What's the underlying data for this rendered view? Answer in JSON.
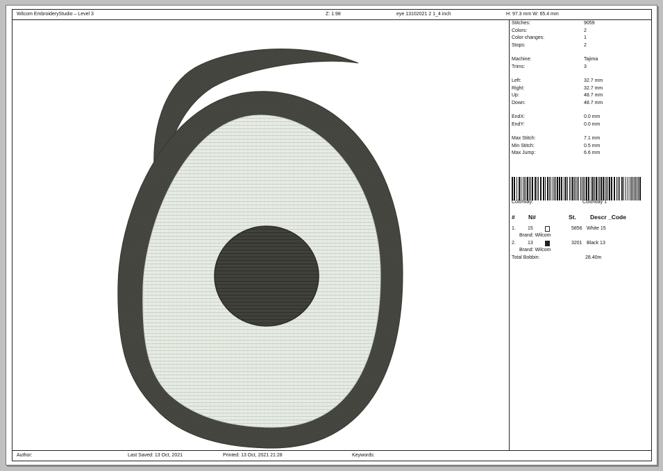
{
  "window": {
    "title": "Wilcom EmbroideryStudio – Level 3"
  },
  "header": {
    "app": "Wilcom EmbroideryStudio – Level 3",
    "zoom": "Z: 1.98",
    "file": "eye 13102021 2  1_4 inch",
    "size": "H: 97.3 mm   W: 65.4 mm"
  },
  "stats": [
    {
      "label": "Stitches:",
      "value": "9059"
    },
    {
      "label": "Colors:",
      "value": "2"
    },
    {
      "label": "Color changes:",
      "value": "1"
    },
    {
      "label": "Stops:",
      "value": "2"
    },
    {
      "label": "Machine:",
      "value": "Tajima"
    },
    {
      "label": "Trims:",
      "value": "3"
    },
    {
      "label": "Left:",
      "value": "32.7 mm"
    },
    {
      "label": "Right:",
      "value": "32.7 mm"
    },
    {
      "label": "Up:",
      "value": "48.7 mm"
    },
    {
      "label": "Down:",
      "value": "48.7 mm"
    },
    {
      "label": "EndX:",
      "value": "0.0 mm"
    },
    {
      "label": "EndY:",
      "value": "0.0 mm"
    },
    {
      "label": "Max Stitch:",
      "value": "7.1 mm"
    },
    {
      "label": "Min Stitch:",
      "value": "0.5 mm"
    },
    {
      "label": "Max Jump:",
      "value": "6.6 mm"
    }
  ],
  "colorway": {
    "label": "Colorway:",
    "value": "Colorway 1"
  },
  "color_table": {
    "headers": [
      "#",
      "N#",
      "St.",
      "Descr _Code"
    ],
    "rows": [
      {
        "index": "1.",
        "number": "15",
        "swatch": "#ffffff",
        "stitches": "5856",
        "descr": "White 15",
        "brand": "Brand: Wilcom"
      },
      {
        "index": "2.",
        "number": "13",
        "swatch": "#222222",
        "stitches": "3201",
        "descr": "Black 13",
        "brand": "Brand: Wilcom"
      }
    ],
    "total_bobbin_label": "Total Bobbin:",
    "total_bobbin_value": "28.40m"
  },
  "footer": {
    "author": "Author:",
    "last_saved": "Last Saved: 13 Oct, 2021",
    "printed": "Printed: 13 Oct, 2021 21:28",
    "keywords": "Keywords:"
  },
  "colors": {
    "thread_dark": "#4a4a44",
    "thread_light": "#e6ebe3",
    "pupil": "#3d3d38"
  }
}
